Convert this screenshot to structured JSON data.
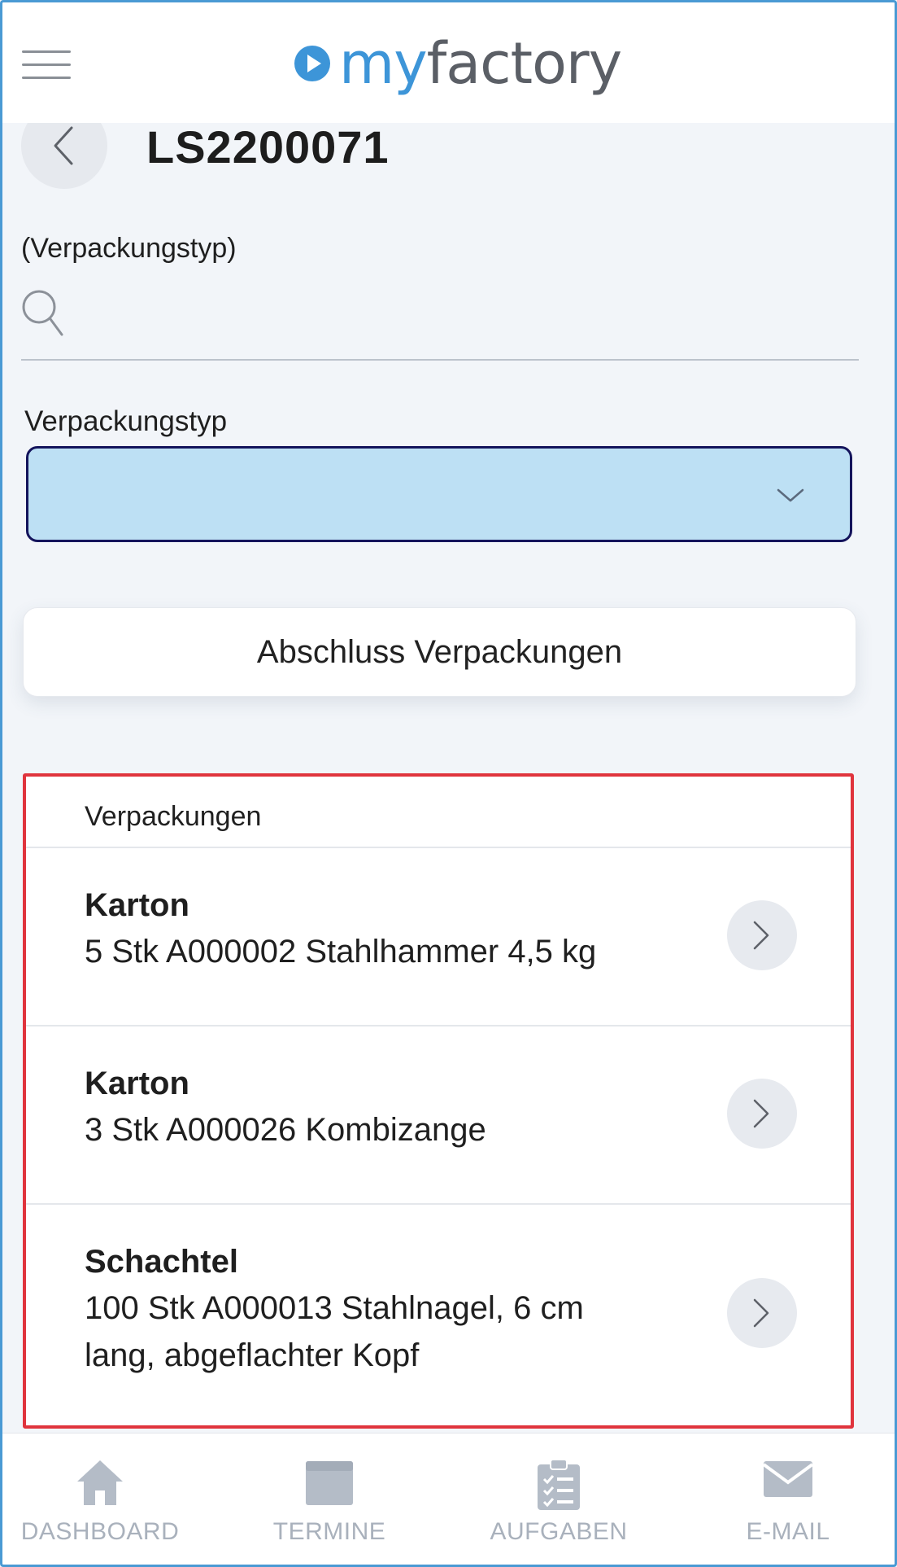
{
  "header": {
    "logo_my": "my",
    "logo_factory": "factory"
  },
  "title": "LS2200071",
  "search": {
    "label": "(Verpackungstyp)",
    "value": "",
    "placeholder": ""
  },
  "select": {
    "label": "Verpackungstyp",
    "value": ""
  },
  "action_button": "Abschluss Verpackungen",
  "list": {
    "header": "Verpackungen",
    "items": [
      {
        "title": "Karton",
        "description": "5 Stk A000002 Stahlhammer 4,5 kg"
      },
      {
        "title": "Karton",
        "description": "3 Stk A000026 Kombizange"
      },
      {
        "title": "Schachtel",
        "description": "100 Stk A000013 Stahlnagel, 6 cm lang, abgeflachter Kopf"
      }
    ]
  },
  "nav": [
    {
      "label": "DASHBOARD",
      "icon": "home-icon"
    },
    {
      "label": "TERMINE",
      "icon": "calendar-icon"
    },
    {
      "label": "AUFGABEN",
      "icon": "clipboard-icon"
    },
    {
      "label": "E-MAIL",
      "icon": "mail-icon"
    }
  ],
  "colors": {
    "brand_blue": "#3d95d8",
    "select_fill": "#bde0f4",
    "highlight_border": "#e0343d",
    "nav_inactive": "#a9b1bc"
  }
}
